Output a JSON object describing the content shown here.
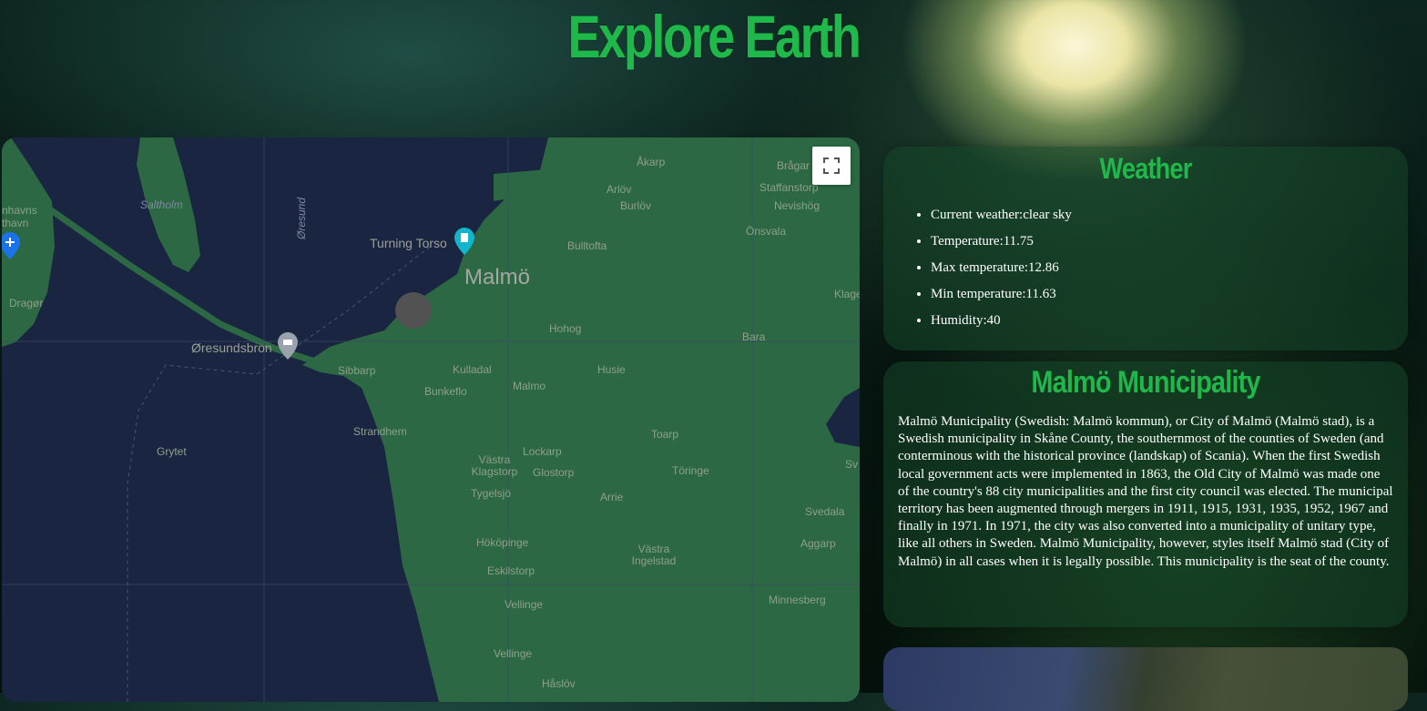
{
  "app": {
    "title": "Explore Earth"
  },
  "map": {
    "fullscreen_label": "Toggle fullscreen view",
    "labels": {
      "malmo": "Malmö",
      "turning_torso": "Turning Torso",
      "oresundsbron": "Øresundsbron",
      "akarp": "Åkarp",
      "arlov": "Arlöv",
      "burlov": "Burlöv",
      "bragar": "Brågar",
      "staffanstorp": "Staffanstorp",
      "nevishog": "Nevishög",
      "onsvala": "Önsvala",
      "bulltofta": "Bulltofta",
      "hohog": "Hohog",
      "bara": "Bara",
      "husie": "Husie",
      "kulladal": "Kulladal",
      "malmo_small": "Malmo",
      "bunkeflo": "Bunkeflo",
      "sibbarp": "Sibbarp",
      "strandhem": "Strandhem",
      "toarp": "Toarp",
      "lockarp": "Lockarp",
      "vastra_klagstorp": "Västra Klagstorp",
      "glostorp": "Glostorp",
      "toringe": "Töringe",
      "tygelsjo": "Tygelsjö",
      "arrie": "Arrie",
      "svedala": "Svedala",
      "hokopinge": "Hököpinge",
      "vastra_ingelstad": "Västra Ingelstad",
      "aggarp": "Aggarp",
      "eskilstorp": "Eskilstorp",
      "vellinge": "Vellinge",
      "minnesberg": "Minnesberg",
      "vellinge2": "Vellinge",
      "haslov": "Håslöv",
      "grytet": "Grytet",
      "saltholm": "Saltholm",
      "oresund": "Øresund",
      "dragor": "Dragør",
      "kastrup": "nhavns thavn",
      "klage": "Klage",
      "sv": "Sv"
    }
  },
  "weather": {
    "heading": "Weather",
    "items": [
      "Current weather:clear sky",
      "Temperature:11.75",
      "Max temperature:12.86",
      "Min temperature:11.63",
      "Humidity:40"
    ]
  },
  "municipality": {
    "heading": "Malmö Municipality",
    "text": "Malmö Municipality (Swedish: Malmö kommun), or City of Malmö (Malmö stad), is a Swedish municipality in Skåne County, the southernmost of the counties of Sweden (and conterminous with the historical province (landskap) of Scania). When the first Swedish local government acts were implemented in 1863, the Old City of Malmö was made one of the country's 88 city municipalities and the first city council was elected. The municipal territory has been augmented through mergers in 1911, 1915, 1931, 1935, 1952, 1967 and finally in 1971. In 1971, the city was also converted into a municipality of unitary type, like all others in Sweden. Malmö Municipality, however, styles itself Malmö stad (City of Malmö) in all cases when it is legally possible. This municipality is the seat of the county."
  },
  "colors": {
    "accent": "#1fb84a",
    "land": "#2c6843",
    "water": "#1a2541"
  }
}
